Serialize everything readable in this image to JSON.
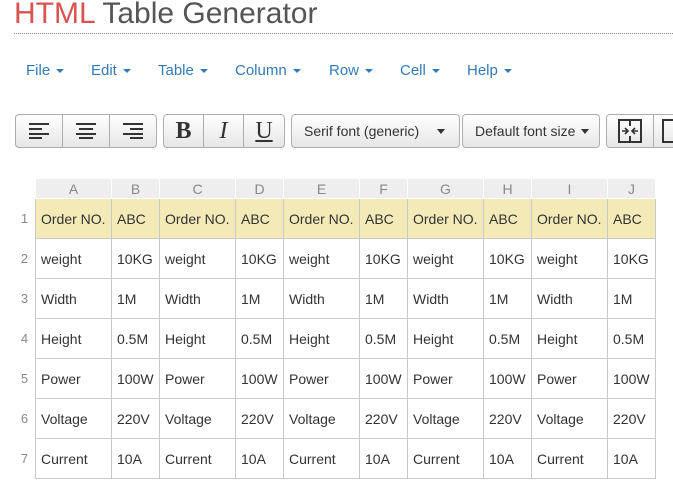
{
  "app": {
    "title_brand": "HTML",
    "title_rest": " Table Generator"
  },
  "menu": [
    {
      "label": "File"
    },
    {
      "label": "Edit"
    },
    {
      "label": "Table"
    },
    {
      "label": "Column"
    },
    {
      "label": "Row"
    },
    {
      "label": "Cell"
    },
    {
      "label": "Help"
    }
  ],
  "toolbar": {
    "font_family": "Serif font (generic)",
    "font_size": "Default font size",
    "bold": "B",
    "italic": "I",
    "underline": "U"
  },
  "icons": {
    "align_left": "align-left-icon",
    "align_center": "align-center-icon",
    "align_right": "align-right-icon",
    "merge": "merge-cells-icon"
  },
  "colors": {
    "brand": "#d9534f",
    "link": "#337ab7",
    "header_row_fill": "#f3eab8"
  },
  "sheet": {
    "column_headers": [
      "A",
      "B",
      "C",
      "D",
      "E",
      "F",
      "G",
      "H",
      "I",
      "J"
    ],
    "row_numbers": [
      "1",
      "2",
      "3",
      "4",
      "5",
      "6",
      "7"
    ],
    "rows": [
      [
        "Order NO.",
        "ABC",
        "Order NO.",
        "ABC",
        "Order NO.",
        "ABC",
        "Order NO.",
        "ABC",
        "Order NO.",
        "ABC"
      ],
      [
        "weight",
        "10KG",
        "weight",
        "10KG",
        "weight",
        "10KG",
        "weight",
        "10KG",
        "weight",
        "10KG"
      ],
      [
        "Width",
        "1M",
        "Width",
        "1M",
        "Width",
        "1M",
        "Width",
        "1M",
        "Width",
        "1M"
      ],
      [
        "Height",
        "0.5M",
        "Height",
        "0.5M",
        "Height",
        "0.5M",
        "Height",
        "0.5M",
        "Height",
        "0.5M"
      ],
      [
        "Power",
        "100W",
        "Power",
        "100W",
        "Power",
        "100W",
        "Power",
        "100W",
        "Power",
        "100W"
      ],
      [
        "Voltage",
        "220V",
        "Voltage",
        "220V",
        "Voltage",
        "220V",
        "Voltage",
        "220V",
        "Voltage",
        "220V"
      ],
      [
        "Current",
        "10A",
        "Current",
        "10A",
        "Current",
        "10A",
        "Current",
        "10A",
        "Current",
        "10A"
      ]
    ]
  }
}
